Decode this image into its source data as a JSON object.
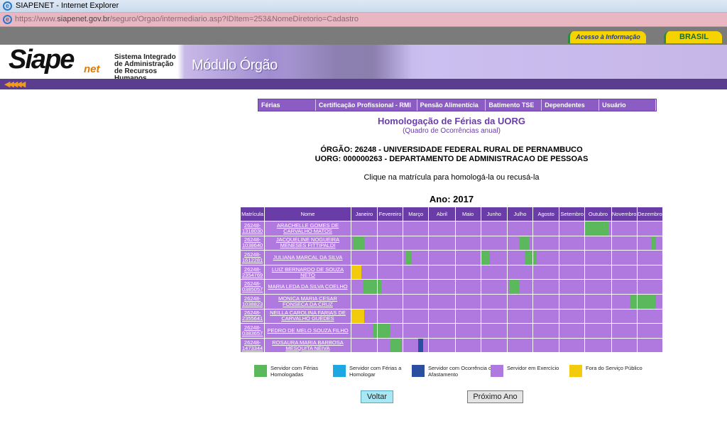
{
  "window": {
    "title": "SIAPENET - Internet Explorer"
  },
  "address": {
    "prefix": "https://www.",
    "domain": "siapenet.gov.br",
    "path": "/seguro/Orgao/intermediario.asp?IDItem=253&NomeDiretorio=Cadastro"
  },
  "govbar": {
    "acesso": "Acesso à Informação",
    "brasil": "BRASIL"
  },
  "banner": {
    "logo": "Siape",
    "logo_net": "net",
    "sistema": "Sistema Integrado de Administração de Recursos Humanos",
    "modulo": "Módulo Órgão"
  },
  "menu": [
    "Férias",
    "Certificação Profissional - RMI",
    "Pensão Alimentícia",
    "Batimento TSE",
    "Dependentes",
    "Usuário"
  ],
  "page": {
    "title": "Homologação de Férias da UORG",
    "subtitle": "(Quadro de Ocorrências anual)",
    "orgao": "ÓRGÃO: 26248 - UNIVERSIDADE FEDERAL RURAL DE PERNAMBUCO",
    "uorg": "UORG: 000000263 - DEPARTAMENTO DE ADMINISTRACAO DE PESSOAS",
    "instruction": "Clique na matrícula para homologá-la ou recusá-la",
    "ano": "Ano: 2017"
  },
  "table": {
    "headers": [
      "Matrícula",
      "Nome",
      "Janeiro",
      "Fevereiro",
      "Março",
      "Abril",
      "Maio",
      "Junho",
      "Julho",
      "Agosto",
      "Setembro",
      "Outubro",
      "Novembro",
      "Dezembro"
    ],
    "rows": [
      {
        "matricula": "26248-1318030",
        "nome": "ARACHELLE GOMES DE CARVALHO MATOS"
      },
      {
        "matricula": "26248-1038640",
        "nome": "JACQUELINE NOGUEIRA MENESES FITTIPALDI"
      },
      {
        "matricula": "26248-1612281",
        "nome": "JULIANA MARCAL DA SILVA"
      },
      {
        "matricula": "26248-2354769",
        "nome": "LUIZ BERNARDO DE SOUZA NETO"
      },
      {
        "matricula": "26248-0385057",
        "nome": "MARIA LEDA DA SILVA COELHO"
      },
      {
        "matricula": "26248-1038823",
        "nome": "MONICA MARIA CESAR FONSECA DA CRUZ"
      },
      {
        "matricula": "26248-2355641",
        "nome": "NEILLA CAROLINA FARIAS DE CARVALHO GUEDES"
      },
      {
        "matricula": "26248-0383657",
        "nome": "PEDRO DE MELO SOUZA FILHO"
      },
      {
        "matricula": "26248-1473344",
        "nome": "ROSAURA MARIA BARBOSA MESQUITA NEIVA"
      }
    ]
  },
  "legend": [
    {
      "label": "Servidor com Férias Homologadas",
      "color": "#5cb85c"
    },
    {
      "label": "Servidor com Férias a Homologar",
      "color": "#1ea7e1"
    },
    {
      "label": "Servidor com Ocorrência de Afastamento",
      "color": "#2a4fa0"
    },
    {
      "label": "Servidor em Exercício",
      "color": "#b079e0"
    },
    {
      "label": "Fora do Serviço Público",
      "color": "#f2cc0c"
    }
  ],
  "buttons": {
    "voltar": "Voltar",
    "proximo": "Próximo Ano"
  }
}
